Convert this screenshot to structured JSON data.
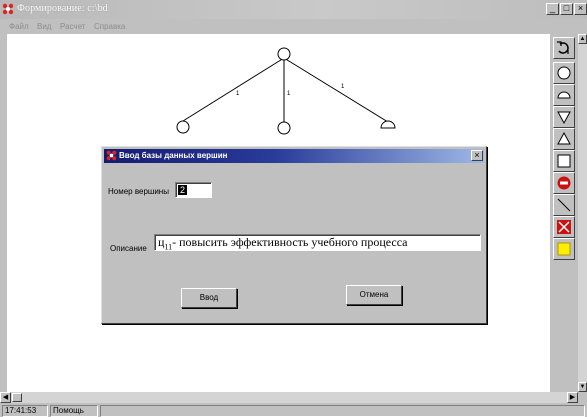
{
  "window": {
    "title": "Формирование: c:\\bd",
    "minimize": "_",
    "maximize": "□",
    "close": "×"
  },
  "menu": [
    "Файл",
    "Вид",
    "Расчет",
    "Справка"
  ],
  "tree": {
    "edge_labels": [
      "1",
      "1",
      "1"
    ],
    "node_shapes": [
      "circle",
      "circle",
      "circle",
      "semicircle"
    ]
  },
  "toolbar": {
    "tools": [
      "undo-icon",
      "circle-icon",
      "semicircle-icon",
      "triangle-down-icon",
      "triangle-up-icon",
      "square-icon",
      "delete-node-icon",
      "line-icon",
      "delete-line-icon",
      "color-icon"
    ]
  },
  "dialog": {
    "title": "Ввод базы данных вершин",
    "close": "×",
    "vertex_label": "Номер вершины",
    "vertex_value": "2",
    "description_label": "Описание",
    "description_prefix": "ц",
    "description_subscript": "11",
    "description_text": "- повысить эффективность учебного процесса",
    "ok_label": "Ввод",
    "cancel_label": "Отмена"
  },
  "statusbar": {
    "time": "17:41:53",
    "help": "Помощь"
  },
  "colors": {
    "dialog_title_start": "#141c70",
    "dialog_title_end": "#9fb8e6",
    "canvas_bg": "#ffffff",
    "accent_red": "#cc1111",
    "accent_yellow": "#ffee00"
  }
}
